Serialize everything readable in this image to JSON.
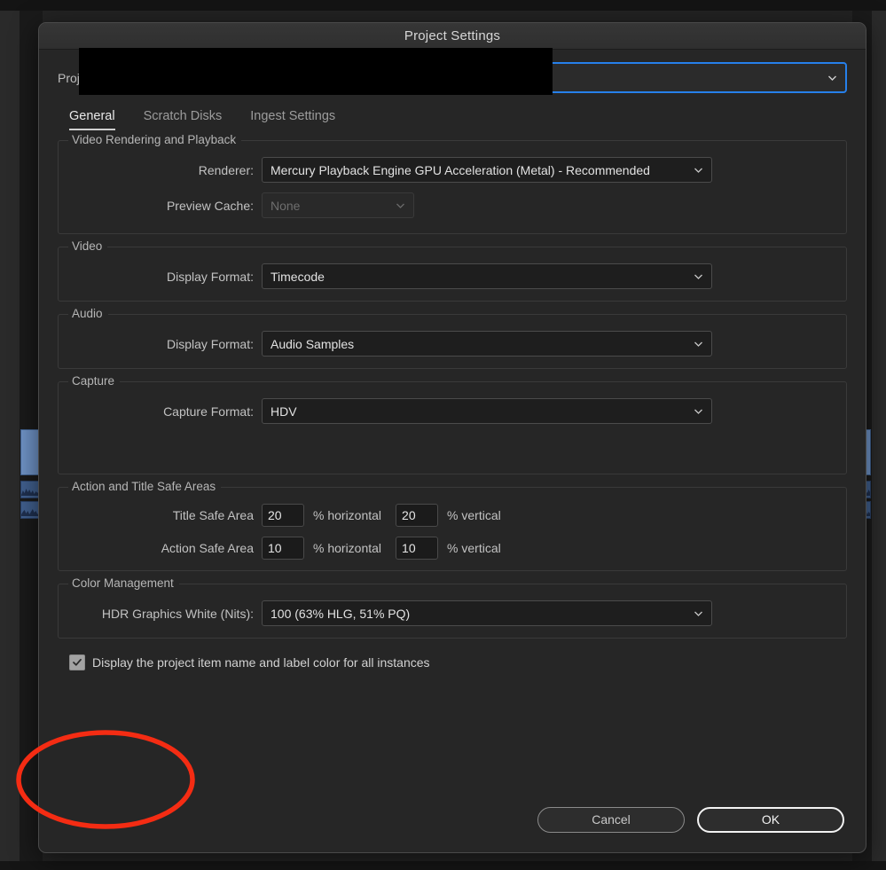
{
  "window": {
    "title": "Project Settings"
  },
  "project_field": {
    "label": "Project:",
    "value": "",
    "redacted": true,
    "chevron_icon": "chevron-down-icon",
    "focus_color": "#2680eb"
  },
  "tabs": [
    {
      "label": "General",
      "active": true
    },
    {
      "label": "Scratch Disks",
      "active": false
    },
    {
      "label": "Ingest Settings",
      "active": false
    }
  ],
  "groups": {
    "video_rendering": {
      "legend": "Video Rendering and Playback",
      "renderer": {
        "label": "Renderer:",
        "value": "Mercury Playback Engine GPU Acceleration (Metal) - Recommended"
      },
      "preview_cache": {
        "label": "Preview Cache:",
        "value": "None",
        "disabled": true
      }
    },
    "video": {
      "legend": "Video",
      "display_format": {
        "label": "Display Format:",
        "value": "Timecode"
      }
    },
    "audio": {
      "legend": "Audio",
      "display_format": {
        "label": "Display Format:",
        "value": "Audio Samples"
      }
    },
    "capture": {
      "legend": "Capture",
      "capture_format": {
        "label": "Capture Format:",
        "value": "HDV"
      }
    },
    "safe_areas": {
      "legend": "Action and Title Safe Areas",
      "title_safe": {
        "label": "Title Safe Area",
        "horizontal": "20",
        "vertical": "20",
        "horizontal_unit": "% horizontal",
        "vertical_unit": "% vertical"
      },
      "action_safe": {
        "label": "Action Safe Area",
        "horizontal": "10",
        "vertical": "10",
        "horizontal_unit": "% horizontal",
        "vertical_unit": "% vertical"
      }
    },
    "color_management": {
      "legend": "Color Management",
      "hdr_graphics_white": {
        "label": "HDR Graphics White (Nits):",
        "value": "100 (63% HLG, 51% PQ)"
      }
    }
  },
  "display_option": {
    "label": "Display the project item name and label color for all instances",
    "checked": true,
    "checkbox_icon": "checkmark-icon"
  },
  "footer": {
    "cancel_label": "Cancel",
    "ok_label": "OK"
  },
  "annotation": {
    "shape": "ellipse",
    "color": "#f42c13",
    "target": "display-option-checkbox"
  }
}
